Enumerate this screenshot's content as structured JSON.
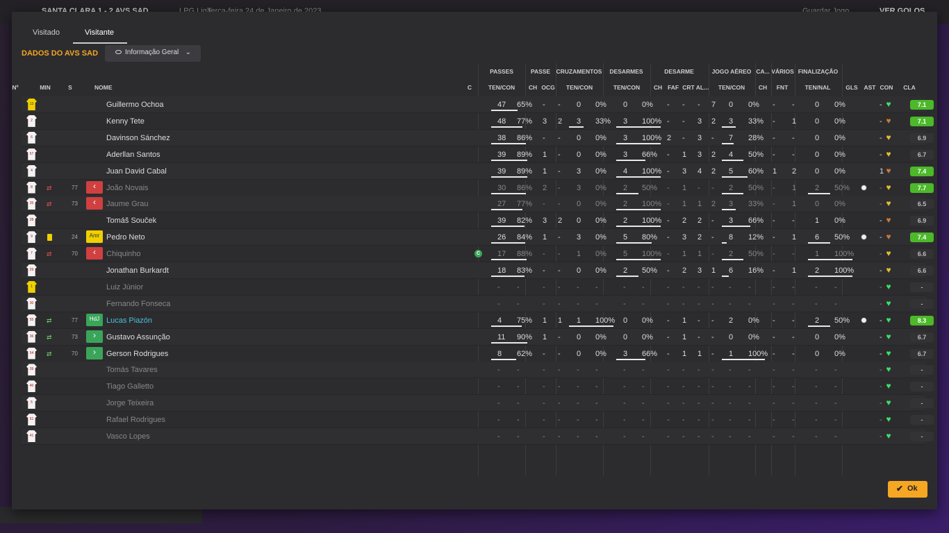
{
  "topbar": {
    "match": "SANTA CLARA 1 - 2 AVS SAD",
    "league": "LPG Liga",
    "date": "Terça-feira 24 de Janeiro de 2023",
    "save": "Guardar Jogo",
    "goals": "VER GOLOS"
  },
  "tabs": [
    "Visitado",
    "Visitante"
  ],
  "title": "DADOS DO AVS SAD",
  "view_select": "Informação Geral",
  "group_headers": {
    "passes": "PASSES",
    "passe": "PASSE",
    "cruz": "CRUZAMENTOS",
    "desarmes": "DESARMES",
    "desarme": "DESARME",
    "aereo": "JOGO AÉREO",
    "ca": "CA...",
    "varios": "VÁRIOS",
    "final": "FINALIZAÇÃO"
  },
  "columns": {
    "num": "Nº",
    "min": "MIN",
    "s": "S",
    "name": "NOME",
    "c": "C",
    "pass_tc": "TEN/CON",
    "ch": "CH",
    "ocg": "OCG",
    "cruz_tc": "TEN/CON",
    "des_tc": "TEN/CON",
    "d_ch": "CH",
    "faf": "FAF",
    "crt": "CRT",
    "al": "AL...",
    "aer_tc": "TEN/CON",
    "ca_ch": "CH",
    "fnt": "FNT",
    "fin_tn": "TEN/NAL",
    "gls": "GLS",
    "ast": "AST",
    "con": "CON",
    "cla": "CLA"
  },
  "players": [
    {
      "num": "13",
      "gk": true,
      "min": "",
      "sub": "",
      "role": "",
      "name": "Guillermo Ochoa",
      "dim": false,
      "c": "",
      "pass": [
        "47",
        "65%"
      ],
      "pass_pct": 65,
      "ch": "-",
      "ocg": "-",
      "cross": [
        "0",
        "0%"
      ],
      "cross_pct": 0,
      "tack": [
        "0",
        "0%"
      ],
      "tack_pct": 0,
      "d": [
        "-",
        "-",
        "-",
        "7"
      ],
      "aer": [
        "0",
        "0%"
      ],
      "aer_pct": 0,
      "ca": "-",
      "fnt": "-",
      "fin": [
        "0",
        "0%"
      ],
      "fin_pct": 0,
      "gls": "",
      "ast": "-",
      "ball": false,
      "con": "#3ee06a",
      "rating": "7.1",
      "rcol": "green"
    },
    {
      "num": "2",
      "gk": false,
      "min": "",
      "sub": "",
      "role": "",
      "name": "Kenny Tete",
      "dim": false,
      "c": "",
      "pass": [
        "48",
        "77%"
      ],
      "pass_pct": 77,
      "ch": "3",
      "ocg": "2",
      "cross": [
        "3",
        "33%"
      ],
      "cross_pct": 33,
      "tack": [
        "3",
        "100%"
      ],
      "tack_pct": 100,
      "d": [
        "-",
        "-",
        "3",
        "2"
      ],
      "aer": [
        "3",
        "33%"
      ],
      "aer_pct": 33,
      "ca": "-",
      "fnt": "1",
      "fin": [
        "0",
        "0%"
      ],
      "fin_pct": 0,
      "gls": "",
      "ast": "-",
      "ball": false,
      "con": "#c87a3c",
      "rating": "7.1",
      "rcol": "green"
    },
    {
      "num": "6",
      "gk": false,
      "min": "",
      "sub": "",
      "role": "",
      "name": "Davinson Sánchez",
      "dim": false,
      "c": "",
      "pass": [
        "38",
        "86%"
      ],
      "pass_pct": 86,
      "ch": "-",
      "ocg": "-",
      "cross": [
        "0",
        "0%"
      ],
      "cross_pct": 0,
      "tack": [
        "3",
        "100%"
      ],
      "tack_pct": 100,
      "d": [
        "2",
        "-",
        "3",
        "-"
      ],
      "aer": [
        "7",
        "28%"
      ],
      "aer_pct": 28,
      "ca": "-",
      "fnt": "-",
      "fin": [
        "0",
        "0%"
      ],
      "fin_pct": 0,
      "gls": "",
      "ast": "-",
      "ball": false,
      "con": "#e0c030",
      "rating": "6.9",
      "rcol": "none"
    },
    {
      "num": "57",
      "gk": false,
      "min": "",
      "sub": "",
      "role": "",
      "name": "Aderllan Santos",
      "dim": false,
      "c": "",
      "pass": [
        "39",
        "89%"
      ],
      "pass_pct": 89,
      "ch": "1",
      "ocg": "-",
      "cross": [
        "0",
        "0%"
      ],
      "cross_pct": 0,
      "tack": [
        "3",
        "66%"
      ],
      "tack_pct": 66,
      "d": [
        "-",
        "1",
        "3",
        "2"
      ],
      "aer": [
        "4",
        "50%"
      ],
      "aer_pct": 50,
      "ca": "-",
      "fnt": "-",
      "fin": [
        "0",
        "0%"
      ],
      "fin_pct": 0,
      "gls": "",
      "ast": "-",
      "ball": false,
      "con": "#e0c030",
      "rating": "6.7",
      "rcol": "none"
    },
    {
      "num": "4",
      "gk": false,
      "min": "",
      "sub": "",
      "role": "",
      "name": "Juan David Cabal",
      "dim": false,
      "c": "",
      "pass": [
        "39",
        "89%"
      ],
      "pass_pct": 89,
      "ch": "1",
      "ocg": "-",
      "cross": [
        "3",
        "0%"
      ],
      "cross_pct": 0,
      "tack": [
        "4",
        "100%"
      ],
      "tack_pct": 100,
      "d": [
        "-",
        "3",
        "4",
        "2"
      ],
      "aer": [
        "5",
        "60%"
      ],
      "aer_pct": 60,
      "ca": "1",
      "fnt": "2",
      "fin": [
        "0",
        "0%"
      ],
      "fin_pct": 0,
      "gls": "",
      "ast": "1",
      "ball": false,
      "con": "#c87a3c",
      "rating": "7.4",
      "rcol": "green"
    },
    {
      "num": "8",
      "gk": false,
      "min": "77",
      "sub": "out",
      "role": "out",
      "name": "João Novais",
      "dim": true,
      "c": "",
      "pass": [
        "30",
        "86%"
      ],
      "pass_pct": 86,
      "ch": "2",
      "ocg": "-",
      "cross": [
        "3",
        "0%"
      ],
      "cross_pct": 0,
      "tack": [
        "2",
        "50%"
      ],
      "tack_pct": 50,
      "d": [
        "-",
        "1",
        "-",
        "-"
      ],
      "aer": [
        "2",
        "50%"
      ],
      "aer_pct": 50,
      "ca": "-",
      "fnt": "1",
      "fin": [
        "2",
        "50%"
      ],
      "fin_pct": 50,
      "gls": "",
      "ast": "-",
      "ball": true,
      "con": "#e0c030",
      "rating": "7.7",
      "rcol": "green"
    },
    {
      "num": "35",
      "gk": false,
      "min": "73",
      "sub": "out",
      "role": "out",
      "name": "Jaume Grau",
      "dim": true,
      "c": "",
      "pass": [
        "27",
        "77%"
      ],
      "pass_pct": 77,
      "ch": "-",
      "ocg": "-",
      "cross": [
        "0",
        "0%"
      ],
      "cross_pct": 0,
      "tack": [
        "2",
        "100%"
      ],
      "tack_pct": 100,
      "d": [
        "-",
        "1",
        "1",
        "2"
      ],
      "aer": [
        "3",
        "33%"
      ],
      "aer_pct": 33,
      "ca": "-",
      "fnt": "1",
      "fin": [
        "0",
        "0%"
      ],
      "fin_pct": 0,
      "gls": "",
      "ast": "-",
      "ball": false,
      "con": "#e0c030",
      "rating": "6.5",
      "rcol": "none"
    },
    {
      "num": "28",
      "gk": false,
      "min": "",
      "sub": "",
      "role": "",
      "name": "Tomáš Souček",
      "dim": false,
      "c": "",
      "pass": [
        "39",
        "82%"
      ],
      "pass_pct": 82,
      "ch": "3",
      "ocg": "2",
      "cross": [
        "0",
        "0%"
      ],
      "cross_pct": 0,
      "tack": [
        "2",
        "100%"
      ],
      "tack_pct": 100,
      "d": [
        "-",
        "2",
        "2",
        "-"
      ],
      "aer": [
        "3",
        "66%"
      ],
      "aer_pct": 66,
      "ca": "-",
      "fnt": "-",
      "fin": [
        "1",
        "0%"
      ],
      "fin_pct": 0,
      "gls": "",
      "ast": "-",
      "ball": false,
      "con": "#c87a3c",
      "rating": "6.9",
      "rcol": "none"
    },
    {
      "num": "9",
      "gk": false,
      "min": "24",
      "sub": "yellow",
      "role": "Amr",
      "name": "Pedro Neto",
      "dim": false,
      "c": "",
      "pass": [
        "26",
        "84%"
      ],
      "pass_pct": 84,
      "ch": "1",
      "ocg": "-",
      "cross": [
        "3",
        "0%"
      ],
      "cross_pct": 0,
      "tack": [
        "5",
        "80%"
      ],
      "tack_pct": 80,
      "d": [
        "-",
        "3",
        "2",
        "-"
      ],
      "aer": [
        "8",
        "12%"
      ],
      "aer_pct": 12,
      "ca": "-",
      "fnt": "1",
      "fin": [
        "6",
        "50%"
      ],
      "fin_pct": 50,
      "gls": "",
      "ast": "-",
      "ball": true,
      "con": "#c87a3c",
      "rating": "7.4",
      "rcol": "green"
    },
    {
      "num": "7",
      "gk": false,
      "min": "70",
      "sub": "out",
      "role": "out",
      "name": "Chiquinho",
      "dim": true,
      "c": "C",
      "pass": [
        "17",
        "88%"
      ],
      "pass_pct": 88,
      "ch": "-",
      "ocg": "-",
      "cross": [
        "1",
        "0%"
      ],
      "cross_pct": 0,
      "tack": [
        "5",
        "100%"
      ],
      "tack_pct": 100,
      "d": [
        "-",
        "1",
        "1",
        "-"
      ],
      "aer": [
        "2",
        "50%"
      ],
      "aer_pct": 50,
      "ca": "-",
      "fnt": "-",
      "fin": [
        "1",
        "100%"
      ],
      "fin_pct": 100,
      "gls": "",
      "ast": "-",
      "ball": false,
      "con": "#e0c030",
      "rating": "6.6",
      "rcol": "none"
    },
    {
      "num": "29",
      "gk": false,
      "min": "",
      "sub": "",
      "role": "",
      "name": "Jonathan Burkardt",
      "dim": false,
      "c": "",
      "pass": [
        "18",
        "83%"
      ],
      "pass_pct": 83,
      "ch": "-",
      "ocg": "-",
      "cross": [
        "0",
        "0%"
      ],
      "cross_pct": 0,
      "tack": [
        "2",
        "50%"
      ],
      "tack_pct": 50,
      "d": [
        "-",
        "2",
        "3",
        "1"
      ],
      "aer": [
        "6",
        "16%"
      ],
      "aer_pct": 16,
      "ca": "-",
      "fnt": "1",
      "fin": [
        "2",
        "100%"
      ],
      "fin_pct": 100,
      "gls": "",
      "ast": "-",
      "ball": false,
      "con": "#e0c030",
      "rating": "6.6",
      "rcol": "none"
    },
    {
      "num": "1",
      "gk": true,
      "min": "",
      "sub": "",
      "role": "",
      "name": "Luiz Júnior",
      "dim": true,
      "c": "",
      "pass": [
        "-",
        "-"
      ],
      "pass_pct": 0,
      "ch": "-",
      "ocg": "-",
      "cross": [
        "-",
        "-"
      ],
      "cross_pct": 0,
      "tack": [
        "-",
        "-"
      ],
      "tack_pct": 0,
      "d": [
        "-",
        "-",
        "-",
        "-"
      ],
      "aer": [
        "-",
        "-"
      ],
      "aer_pct": 0,
      "ca": "-",
      "fnt": "-",
      "fin": [
        "-",
        "-"
      ],
      "fin_pct": 0,
      "gls": "",
      "ast": "-",
      "ball": false,
      "con": "#3ee06a",
      "rating": "-",
      "rcol": "none"
    },
    {
      "num": "30",
      "gk": false,
      "min": "",
      "sub": "",
      "role": "",
      "name": "Fernando Fonseca",
      "dim": true,
      "c": "",
      "pass": [
        "-",
        "-"
      ],
      "pass_pct": 0,
      "ch": "-",
      "ocg": "-",
      "cross": [
        "-",
        "-"
      ],
      "cross_pct": 0,
      "tack": [
        "-",
        "-"
      ],
      "tack_pct": 0,
      "d": [
        "-",
        "-",
        "-",
        "-"
      ],
      "aer": [
        "-",
        "-"
      ],
      "aer_pct": 0,
      "ca": "-",
      "fnt": "-",
      "fin": [
        "-",
        "-"
      ],
      "fin_pct": 0,
      "gls": "",
      "ast": "-",
      "ball": false,
      "con": "#3ee06a",
      "rating": "-",
      "rcol": "none"
    },
    {
      "num": "55",
      "gk": false,
      "min": "77",
      "sub": "in",
      "role": "HdJ",
      "name": "Lucas Piazón",
      "dim": false,
      "cyan": true,
      "c": "",
      "pass": [
        "4",
        "75%"
      ],
      "pass_pct": 75,
      "ch": "1",
      "ocg": "1",
      "cross": [
        "1",
        "100%"
      ],
      "cross_pct": 100,
      "tack": [
        "0",
        "0%"
      ],
      "tack_pct": 0,
      "d": [
        "-",
        "1",
        "-",
        "-"
      ],
      "aer": [
        "2",
        "0%"
      ],
      "aer_pct": 0,
      "ca": "-",
      "fnt": "-",
      "fin": [
        "2",
        "50%"
      ],
      "fin_pct": 50,
      "gls": "",
      "ast": "-",
      "ball": true,
      "con": "#3ee06a",
      "rating": "8.3",
      "rcol": "green"
    },
    {
      "num": "36",
      "gk": false,
      "min": "73",
      "sub": "in",
      "role": "in",
      "name": "Gustavo Assunção",
      "dim": false,
      "c": "",
      "pass": [
        "11",
        "90%"
      ],
      "pass_pct": 90,
      "ch": "1",
      "ocg": "-",
      "cross": [
        "0",
        "0%"
      ],
      "cross_pct": 0,
      "tack": [
        "0",
        "0%"
      ],
      "tack_pct": 0,
      "d": [
        "-",
        "1",
        "-",
        "-"
      ],
      "aer": [
        "0",
        "0%"
      ],
      "aer_pct": 0,
      "ca": "-",
      "fnt": "-",
      "fin": [
        "0",
        "0%"
      ],
      "fin_pct": 0,
      "gls": "",
      "ast": "-",
      "ball": false,
      "con": "#3ee06a",
      "rating": "6.7",
      "rcol": "none"
    },
    {
      "num": "54",
      "gk": false,
      "min": "70",
      "sub": "in",
      "role": "in",
      "name": "Gerson Rodrigues",
      "dim": false,
      "c": "",
      "pass": [
        "8",
        "62%"
      ],
      "pass_pct": 62,
      "ch": "-",
      "ocg": "-",
      "cross": [
        "0",
        "0%"
      ],
      "cross_pct": 0,
      "tack": [
        "3",
        "66%"
      ],
      "tack_pct": 66,
      "d": [
        "-",
        "1",
        "1",
        "-"
      ],
      "aer": [
        "1",
        "100%"
      ],
      "aer_pct": 100,
      "ca": "-",
      "fnt": "-",
      "fin": [
        "0",
        "0%"
      ],
      "fin_pct": 0,
      "gls": "",
      "ast": "-",
      "ball": false,
      "con": "#3ee06a",
      "rating": "6.7",
      "rcol": "none"
    },
    {
      "num": "39",
      "gk": false,
      "min": "",
      "sub": "",
      "role": "",
      "name": "Tomás Tavares",
      "dim": true,
      "c": "",
      "pass": [
        "-",
        "-"
      ],
      "pass_pct": 0,
      "ch": "-",
      "ocg": "-",
      "cross": [
        "-",
        "-"
      ],
      "cross_pct": 0,
      "tack": [
        "-",
        "-"
      ],
      "tack_pct": 0,
      "d": [
        "-",
        "-",
        "-",
        "-"
      ],
      "aer": [
        "-",
        "-"
      ],
      "aer_pct": 0,
      "ca": "-",
      "fnt": "-",
      "fin": [
        "-",
        "-"
      ],
      "fin_pct": 0,
      "gls": "",
      "ast": "-",
      "ball": false,
      "con": "#3ee06a",
      "rating": "-",
      "rcol": "none"
    },
    {
      "num": "40",
      "gk": false,
      "min": "",
      "sub": "",
      "role": "",
      "name": "Tiago Galletto",
      "dim": true,
      "c": "",
      "pass": [
        "-",
        "-"
      ],
      "pass_pct": 0,
      "ch": "-",
      "ocg": "-",
      "cross": [
        "-",
        "-"
      ],
      "cross_pct": 0,
      "tack": [
        "-",
        "-"
      ],
      "tack_pct": 0,
      "d": [
        "-",
        "-",
        "-",
        "-"
      ],
      "aer": [
        "-",
        "-"
      ],
      "aer_pct": 0,
      "ca": "-",
      "fnt": "-",
      "fin": [
        "-",
        "-"
      ],
      "fin_pct": 0,
      "gls": "",
      "ast": "-",
      "ball": false,
      "con": "#3ee06a",
      "rating": "-",
      "rcol": "none"
    },
    {
      "num": "5",
      "gk": false,
      "min": "",
      "sub": "",
      "role": "",
      "name": "Jorge Teixeira",
      "dim": true,
      "c": "",
      "pass": [
        "-",
        "-"
      ],
      "pass_pct": 0,
      "ch": "-",
      "ocg": "-",
      "cross": [
        "-",
        "-"
      ],
      "cross_pct": 0,
      "tack": [
        "-",
        "-"
      ],
      "tack_pct": 0,
      "d": [
        "-",
        "-",
        "-",
        "-"
      ],
      "aer": [
        "-",
        "-"
      ],
      "aer_pct": 0,
      "ca": "-",
      "fnt": "-",
      "fin": [
        "-",
        "-"
      ],
      "fin_pct": 0,
      "gls": "",
      "ast": "-",
      "ball": false,
      "con": "#3ee06a",
      "rating": "-",
      "rcol": "none"
    },
    {
      "num": "51",
      "gk": false,
      "min": "",
      "sub": "",
      "role": "",
      "name": "Rafael Rodrigues",
      "dim": true,
      "c": "",
      "pass": [
        "-",
        "-"
      ],
      "pass_pct": 0,
      "ch": "-",
      "ocg": "-",
      "cross": [
        "-",
        "-"
      ],
      "cross_pct": 0,
      "tack": [
        "-",
        "-"
      ],
      "tack_pct": 0,
      "d": [
        "-",
        "-",
        "-",
        "-"
      ],
      "aer": [
        "-",
        "-"
      ],
      "aer_pct": 0,
      "ca": "-",
      "fnt": "-",
      "fin": [
        "-",
        "-"
      ],
      "fin_pct": 0,
      "gls": "",
      "ast": "-",
      "ball": false,
      "con": "#3ee06a",
      "rating": "-",
      "rcol": "none"
    },
    {
      "num": "41",
      "gk": false,
      "min": "",
      "sub": "",
      "role": "",
      "name": "Vasco Lopes",
      "dim": true,
      "c": "",
      "pass": [
        "-",
        "-"
      ],
      "pass_pct": 0,
      "ch": "-",
      "ocg": "-",
      "cross": [
        "-",
        "-"
      ],
      "cross_pct": 0,
      "tack": [
        "-",
        "-"
      ],
      "tack_pct": 0,
      "d": [
        "-",
        "-",
        "-",
        "-"
      ],
      "aer": [
        "-",
        "-"
      ],
      "aer_pct": 0,
      "ca": "-",
      "fnt": "-",
      "fin": [
        "-",
        "-"
      ],
      "fin_pct": 0,
      "gls": "",
      "ast": "-",
      "ball": false,
      "con": "#3ee06a",
      "rating": "-",
      "rcol": "none"
    }
  ],
  "ok_label": "Ok"
}
